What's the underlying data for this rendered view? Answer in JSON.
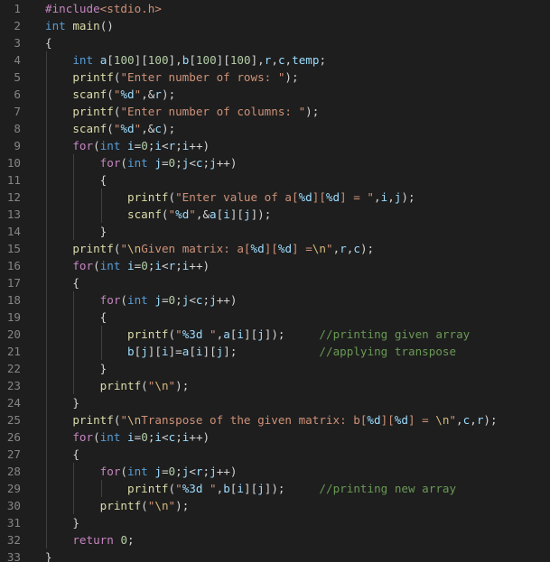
{
  "colors": {
    "background": "#1e1e1e",
    "line_number": "#858585",
    "keyword": "#569cd6",
    "control": "#c586c0",
    "function": "#dcdcaa",
    "string": "#ce9178",
    "escape": "#d7ba7d",
    "variable": "#9cdcfe",
    "number": "#b5cea8",
    "comment": "#6a9955",
    "text": "#d4d4d4"
  },
  "editor": {
    "lines": [
      {
        "n": "1",
        "t": [
          [
            "pre",
            "#include"
          ],
          [
            "inc",
            "<stdio.h>"
          ]
        ]
      },
      {
        "n": "2",
        "t": [
          [
            "kw",
            "int"
          ],
          [
            "plain",
            " "
          ],
          [
            "fn",
            "main"
          ],
          [
            "plain",
            "()"
          ]
        ]
      },
      {
        "n": "3",
        "t": [
          [
            "plain",
            "{"
          ]
        ]
      },
      {
        "n": "4",
        "t": [
          [
            "plain",
            "    "
          ],
          [
            "kw",
            "int"
          ],
          [
            "plain",
            " "
          ],
          [
            "var",
            "a"
          ],
          [
            "plain",
            "["
          ],
          [
            "num",
            "100"
          ],
          [
            "plain",
            "]["
          ],
          [
            "num",
            "100"
          ],
          [
            "plain",
            "],"
          ],
          [
            "var",
            "b"
          ],
          [
            "plain",
            "["
          ],
          [
            "num",
            "100"
          ],
          [
            "plain",
            "]["
          ],
          [
            "num",
            "100"
          ],
          [
            "plain",
            "],"
          ],
          [
            "var",
            "r"
          ],
          [
            "plain",
            ","
          ],
          [
            "var",
            "c"
          ],
          [
            "plain",
            ","
          ],
          [
            "var",
            "temp"
          ],
          [
            "plain",
            ";"
          ]
        ]
      },
      {
        "n": "5",
        "t": [
          [
            "plain",
            "    "
          ],
          [
            "fn",
            "printf"
          ],
          [
            "plain",
            "("
          ],
          [
            "str",
            "\"Enter number of rows: \""
          ],
          [
            "plain",
            ");"
          ]
        ]
      },
      {
        "n": "6",
        "t": [
          [
            "plain",
            "    "
          ],
          [
            "fn",
            "scanf"
          ],
          [
            "plain",
            "("
          ],
          [
            "str",
            "\""
          ],
          [
            "fmt",
            "%d"
          ],
          [
            "str",
            "\""
          ],
          [
            "plain",
            ",&"
          ],
          [
            "var",
            "r"
          ],
          [
            "plain",
            ");"
          ]
        ]
      },
      {
        "n": "7",
        "t": [
          [
            "plain",
            "    "
          ],
          [
            "fn",
            "printf"
          ],
          [
            "plain",
            "("
          ],
          [
            "str",
            "\"Enter number of columns: \""
          ],
          [
            "plain",
            ");"
          ]
        ]
      },
      {
        "n": "8",
        "t": [
          [
            "plain",
            "    "
          ],
          [
            "fn",
            "scanf"
          ],
          [
            "plain",
            "("
          ],
          [
            "str",
            "\""
          ],
          [
            "fmt",
            "%d"
          ],
          [
            "str",
            "\""
          ],
          [
            "plain",
            ",&"
          ],
          [
            "var",
            "c"
          ],
          [
            "plain",
            ");"
          ]
        ]
      },
      {
        "n": "9",
        "t": [
          [
            "plain",
            "    "
          ],
          [
            "ctrl",
            "for"
          ],
          [
            "plain",
            "("
          ],
          [
            "kw",
            "int"
          ],
          [
            "plain",
            " "
          ],
          [
            "var",
            "i"
          ],
          [
            "plain",
            "="
          ],
          [
            "num",
            "0"
          ],
          [
            "plain",
            ";"
          ],
          [
            "var",
            "i"
          ],
          [
            "plain",
            "<"
          ],
          [
            "var",
            "r"
          ],
          [
            "plain",
            ";"
          ],
          [
            "var",
            "i"
          ],
          [
            "plain",
            "++)"
          ]
        ]
      },
      {
        "n": "10",
        "t": [
          [
            "plain",
            "        "
          ],
          [
            "ctrl",
            "for"
          ],
          [
            "plain",
            "("
          ],
          [
            "kw",
            "int"
          ],
          [
            "plain",
            " "
          ],
          [
            "var",
            "j"
          ],
          [
            "plain",
            "="
          ],
          [
            "num",
            "0"
          ],
          [
            "plain",
            ";"
          ],
          [
            "var",
            "j"
          ],
          [
            "plain",
            "<"
          ],
          [
            "var",
            "c"
          ],
          [
            "plain",
            ";"
          ],
          [
            "var",
            "j"
          ],
          [
            "plain",
            "++)"
          ]
        ]
      },
      {
        "n": "11",
        "t": [
          [
            "plain",
            "        {"
          ]
        ]
      },
      {
        "n": "12",
        "t": [
          [
            "plain",
            "            "
          ],
          [
            "fn",
            "printf"
          ],
          [
            "plain",
            "("
          ],
          [
            "str",
            "\"Enter value of a["
          ],
          [
            "fmt",
            "%d"
          ],
          [
            "str",
            "]["
          ],
          [
            "fmt",
            "%d"
          ],
          [
            "str",
            "] = \""
          ],
          [
            "plain",
            ","
          ],
          [
            "var",
            "i"
          ],
          [
            "plain",
            ","
          ],
          [
            "var",
            "j"
          ],
          [
            "plain",
            ");"
          ]
        ]
      },
      {
        "n": "13",
        "t": [
          [
            "plain",
            "            "
          ],
          [
            "fn",
            "scanf"
          ],
          [
            "plain",
            "("
          ],
          [
            "str",
            "\""
          ],
          [
            "fmt",
            "%d"
          ],
          [
            "str",
            "\""
          ],
          [
            "plain",
            ",&"
          ],
          [
            "var",
            "a"
          ],
          [
            "plain",
            "["
          ],
          [
            "var",
            "i"
          ],
          [
            "plain",
            "]["
          ],
          [
            "var",
            "j"
          ],
          [
            "plain",
            "]);"
          ]
        ]
      },
      {
        "n": "14",
        "t": [
          [
            "plain",
            "        }"
          ]
        ]
      },
      {
        "n": "15",
        "t": [
          [
            "plain",
            "    "
          ],
          [
            "fn",
            "printf"
          ],
          [
            "plain",
            "("
          ],
          [
            "str",
            "\""
          ],
          [
            "esc",
            "\\n"
          ],
          [
            "str",
            "Given matrix: a["
          ],
          [
            "fmt",
            "%d"
          ],
          [
            "str",
            "]["
          ],
          [
            "fmt",
            "%d"
          ],
          [
            "str",
            "] ="
          ],
          [
            "esc",
            "\\n"
          ],
          [
            "str",
            "\""
          ],
          [
            "plain",
            ","
          ],
          [
            "var",
            "r"
          ],
          [
            "plain",
            ","
          ],
          [
            "var",
            "c"
          ],
          [
            "plain",
            ");"
          ]
        ]
      },
      {
        "n": "16",
        "t": [
          [
            "plain",
            "    "
          ],
          [
            "ctrl",
            "for"
          ],
          [
            "plain",
            "("
          ],
          [
            "kw",
            "int"
          ],
          [
            "plain",
            " "
          ],
          [
            "var",
            "i"
          ],
          [
            "plain",
            "="
          ],
          [
            "num",
            "0"
          ],
          [
            "plain",
            ";"
          ],
          [
            "var",
            "i"
          ],
          [
            "plain",
            "<"
          ],
          [
            "var",
            "r"
          ],
          [
            "plain",
            ";"
          ],
          [
            "var",
            "i"
          ],
          [
            "plain",
            "++)"
          ]
        ]
      },
      {
        "n": "17",
        "t": [
          [
            "plain",
            "    {"
          ]
        ]
      },
      {
        "n": "18",
        "t": [
          [
            "plain",
            "        "
          ],
          [
            "ctrl",
            "for"
          ],
          [
            "plain",
            "("
          ],
          [
            "kw",
            "int"
          ],
          [
            "plain",
            " "
          ],
          [
            "var",
            "j"
          ],
          [
            "plain",
            "="
          ],
          [
            "num",
            "0"
          ],
          [
            "plain",
            ";"
          ],
          [
            "var",
            "j"
          ],
          [
            "plain",
            "<"
          ],
          [
            "var",
            "c"
          ],
          [
            "plain",
            ";"
          ],
          [
            "var",
            "j"
          ],
          [
            "plain",
            "++)"
          ]
        ]
      },
      {
        "n": "19",
        "t": [
          [
            "plain",
            "        {"
          ]
        ]
      },
      {
        "n": "20",
        "t": [
          [
            "plain",
            "            "
          ],
          [
            "fn",
            "printf"
          ],
          [
            "plain",
            "("
          ],
          [
            "str",
            "\""
          ],
          [
            "fmt",
            "%3d"
          ],
          [
            "str",
            " \""
          ],
          [
            "plain",
            ","
          ],
          [
            "var",
            "a"
          ],
          [
            "plain",
            "["
          ],
          [
            "var",
            "i"
          ],
          [
            "plain",
            "]["
          ],
          [
            "var",
            "j"
          ],
          [
            "plain",
            "]);     "
          ],
          [
            "cmt",
            "//printing given array"
          ]
        ]
      },
      {
        "n": "21",
        "t": [
          [
            "plain",
            "            "
          ],
          [
            "var",
            "b"
          ],
          [
            "plain",
            "["
          ],
          [
            "var",
            "j"
          ],
          [
            "plain",
            "]["
          ],
          [
            "var",
            "i"
          ],
          [
            "plain",
            "]="
          ],
          [
            "var",
            "a"
          ],
          [
            "plain",
            "["
          ],
          [
            "var",
            "i"
          ],
          [
            "plain",
            "]["
          ],
          [
            "var",
            "j"
          ],
          [
            "plain",
            "];            "
          ],
          [
            "cmt",
            "//applying transpose"
          ]
        ]
      },
      {
        "n": "22",
        "t": [
          [
            "plain",
            "        }"
          ]
        ]
      },
      {
        "n": "23",
        "t": [
          [
            "plain",
            "        "
          ],
          [
            "fn",
            "printf"
          ],
          [
            "plain",
            "("
          ],
          [
            "str",
            "\""
          ],
          [
            "esc",
            "\\n"
          ],
          [
            "str",
            "\""
          ],
          [
            "plain",
            ");"
          ]
        ]
      },
      {
        "n": "24",
        "t": [
          [
            "plain",
            "    }"
          ]
        ]
      },
      {
        "n": "25",
        "t": [
          [
            "plain",
            "    "
          ],
          [
            "fn",
            "printf"
          ],
          [
            "plain",
            "("
          ],
          [
            "str",
            "\""
          ],
          [
            "esc",
            "\\n"
          ],
          [
            "str",
            "Transpose of the given matrix: b["
          ],
          [
            "fmt",
            "%d"
          ],
          [
            "str",
            "]["
          ],
          [
            "fmt",
            "%d"
          ],
          [
            "str",
            "] = "
          ],
          [
            "esc",
            "\\n"
          ],
          [
            "str",
            "\""
          ],
          [
            "plain",
            ","
          ],
          [
            "var",
            "c"
          ],
          [
            "plain",
            ","
          ],
          [
            "var",
            "r"
          ],
          [
            "plain",
            ");"
          ]
        ]
      },
      {
        "n": "26",
        "t": [
          [
            "plain",
            "    "
          ],
          [
            "ctrl",
            "for"
          ],
          [
            "plain",
            "("
          ],
          [
            "kw",
            "int"
          ],
          [
            "plain",
            " "
          ],
          [
            "var",
            "i"
          ],
          [
            "plain",
            "="
          ],
          [
            "num",
            "0"
          ],
          [
            "plain",
            ";"
          ],
          [
            "var",
            "i"
          ],
          [
            "plain",
            "<"
          ],
          [
            "var",
            "c"
          ],
          [
            "plain",
            ";"
          ],
          [
            "var",
            "i"
          ],
          [
            "plain",
            "++)"
          ]
        ]
      },
      {
        "n": "27",
        "t": [
          [
            "plain",
            "    {"
          ]
        ]
      },
      {
        "n": "28",
        "t": [
          [
            "plain",
            "        "
          ],
          [
            "ctrl",
            "for"
          ],
          [
            "plain",
            "("
          ],
          [
            "kw",
            "int"
          ],
          [
            "plain",
            " "
          ],
          [
            "var",
            "j"
          ],
          [
            "plain",
            "="
          ],
          [
            "num",
            "0"
          ],
          [
            "plain",
            ";"
          ],
          [
            "var",
            "j"
          ],
          [
            "plain",
            "<"
          ],
          [
            "var",
            "r"
          ],
          [
            "plain",
            ";"
          ],
          [
            "var",
            "j"
          ],
          [
            "plain",
            "++)"
          ]
        ]
      },
      {
        "n": "29",
        "t": [
          [
            "plain",
            "            "
          ],
          [
            "fn",
            "printf"
          ],
          [
            "plain",
            "("
          ],
          [
            "str",
            "\""
          ],
          [
            "fmt",
            "%3d"
          ],
          [
            "str",
            " \""
          ],
          [
            "plain",
            ","
          ],
          [
            "var",
            "b"
          ],
          [
            "plain",
            "["
          ],
          [
            "var",
            "i"
          ],
          [
            "plain",
            "]["
          ],
          [
            "var",
            "j"
          ],
          [
            "plain",
            "]);     "
          ],
          [
            "cmt",
            "//printing new array"
          ]
        ]
      },
      {
        "n": "30",
        "t": [
          [
            "plain",
            "        "
          ],
          [
            "fn",
            "printf"
          ],
          [
            "plain",
            "("
          ],
          [
            "str",
            "\""
          ],
          [
            "esc",
            "\\n"
          ],
          [
            "str",
            "\""
          ],
          [
            "plain",
            ");"
          ]
        ]
      },
      {
        "n": "31",
        "t": [
          [
            "plain",
            "    }"
          ]
        ]
      },
      {
        "n": "32",
        "t": [
          [
            "plain",
            "    "
          ],
          [
            "ctrl",
            "return"
          ],
          [
            "plain",
            " "
          ],
          [
            "num",
            "0"
          ],
          [
            "plain",
            ";"
          ]
        ]
      },
      {
        "n": "33",
        "t": [
          [
            "plain",
            "}"
          ]
        ]
      }
    ]
  }
}
